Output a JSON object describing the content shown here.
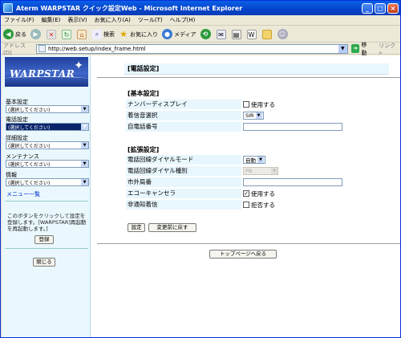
{
  "window": {
    "title": "Aterm WARPSTAR クイック設定Web - Microsoft Internet Explorer",
    "btn_min": "_",
    "btn_max": "□",
    "btn_close": "×"
  },
  "menu": [
    "ファイル(F)",
    "編集(E)",
    "表示(V)",
    "お気に入り(A)",
    "ツール(T)",
    "ヘルプ(H)"
  ],
  "toolbar": {
    "back": "戻る",
    "search": "検索",
    "favorites": "お気に入り",
    "media": "メディア"
  },
  "address": {
    "label": "アドレス(D)",
    "url": "http://web.setup/index_frame.html",
    "go": "移動",
    "links": "リンク »"
  },
  "sidebar": {
    "logo": "WARPSTAR",
    "items": [
      {
        "label": "基本設定",
        "value": "(選択してください)"
      },
      {
        "label": "電話設定",
        "value": "(選択してください)"
      },
      {
        "label": "詳細設定",
        "value": "(選択してください)"
      },
      {
        "label": "メンテナンス",
        "value": "(選択してください)"
      },
      {
        "label": "情報",
        "value": "(選択してください)"
      }
    ],
    "menu_list": "メニュー一覧",
    "note": "このボタンをクリックして設定を登録します。[WARPSTAR]再起動を再起動します。]",
    "register_button": "登録",
    "close_button": "閉じる"
  },
  "main": {
    "header": "[電話設定]",
    "basic_title": "[基本設定]",
    "basic_rows": [
      {
        "label": "ナンバーディスプレイ",
        "type": "checkbox",
        "checked": false,
        "text": "使用する"
      },
      {
        "label": "着信音選択",
        "type": "select",
        "value": "SIR"
      },
      {
        "label": "自電話番号",
        "type": "input",
        "value": ""
      }
    ],
    "ext_title": "[拡張設定]",
    "ext_rows": [
      {
        "label": "電話回線ダイヤルモード",
        "type": "select",
        "value": "自動"
      },
      {
        "label": "電話回線ダイヤル種別",
        "type": "select",
        "value": "PB",
        "disabled": true
      },
      {
        "label": "市外局番",
        "type": "input",
        "value": ""
      },
      {
        "label": "エコーキャンセラ",
        "type": "checkbox",
        "checked": true,
        "text": "使用する"
      },
      {
        "label": "非通知着信",
        "type": "checkbox",
        "checked": false,
        "text": "拒否する"
      }
    ],
    "set_button": "設定",
    "revert_button": "変更前に戻す",
    "top_button": "トップページへ戻る"
  }
}
